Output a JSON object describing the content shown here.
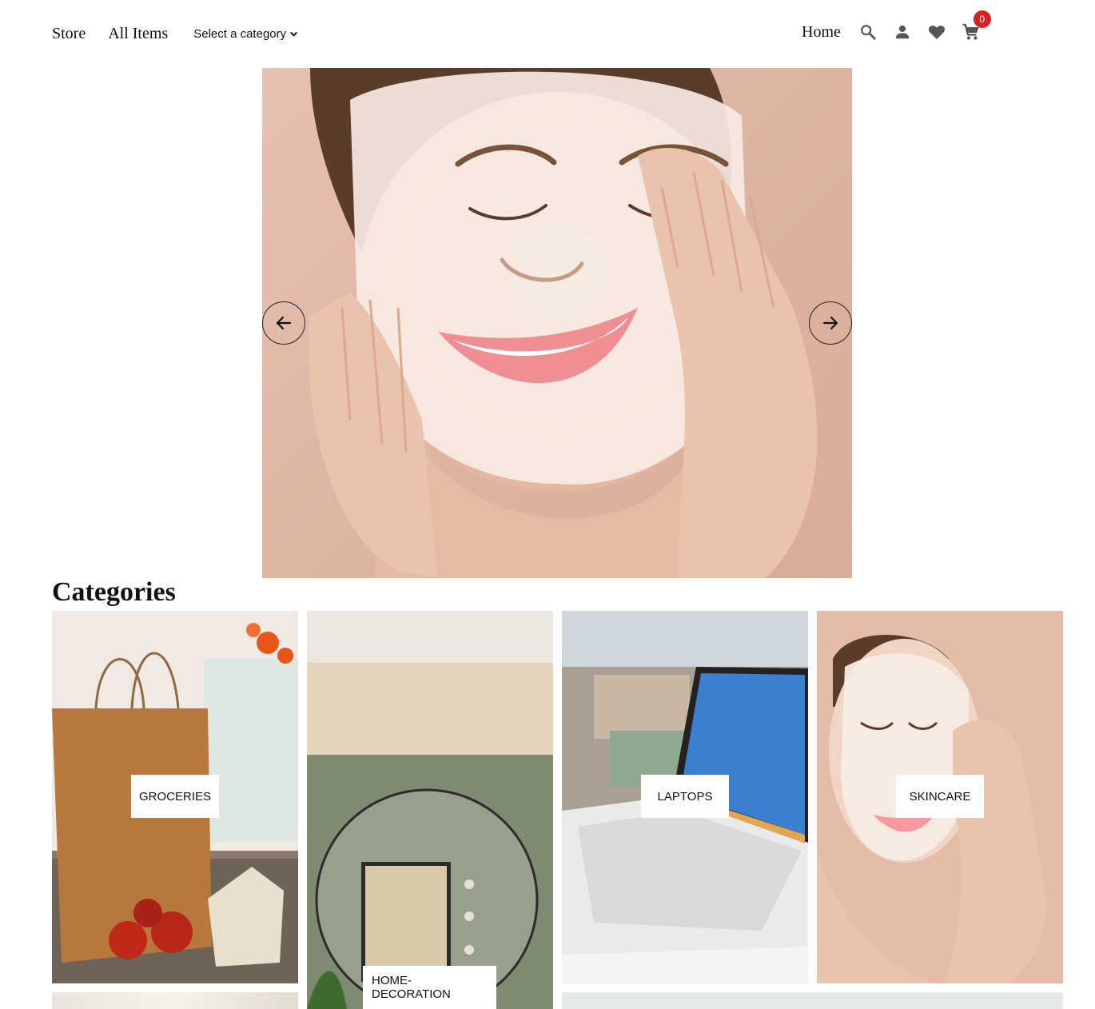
{
  "header": {
    "nav": {
      "store": "Store",
      "all_items": "All Items",
      "category_select": "Select a category"
    },
    "right": {
      "home": "Home",
      "cart_count": "0",
      "icons": [
        "search-icon",
        "user-icon",
        "heart-icon",
        "cart-icon"
      ]
    }
  },
  "hero": {
    "slide_image": "woman-face-mask-skincare",
    "prev_icon": "arrow-left-icon",
    "next_icon": "arrow-right-icon"
  },
  "categories": {
    "title": "Categories",
    "items": [
      {
        "label": "GROCERIES",
        "image": "paper-bag-apples"
      },
      {
        "label": "HOME-DECORATION",
        "image": "round-mirror-plants"
      },
      {
        "label": "LAPTOPS",
        "image": "laptop-city-view"
      },
      {
        "label": "SKINCARE",
        "image": "woman-face-mask"
      }
    ]
  },
  "colors": {
    "badge": "#d32222",
    "icon": "#555555",
    "text": "#111111"
  }
}
